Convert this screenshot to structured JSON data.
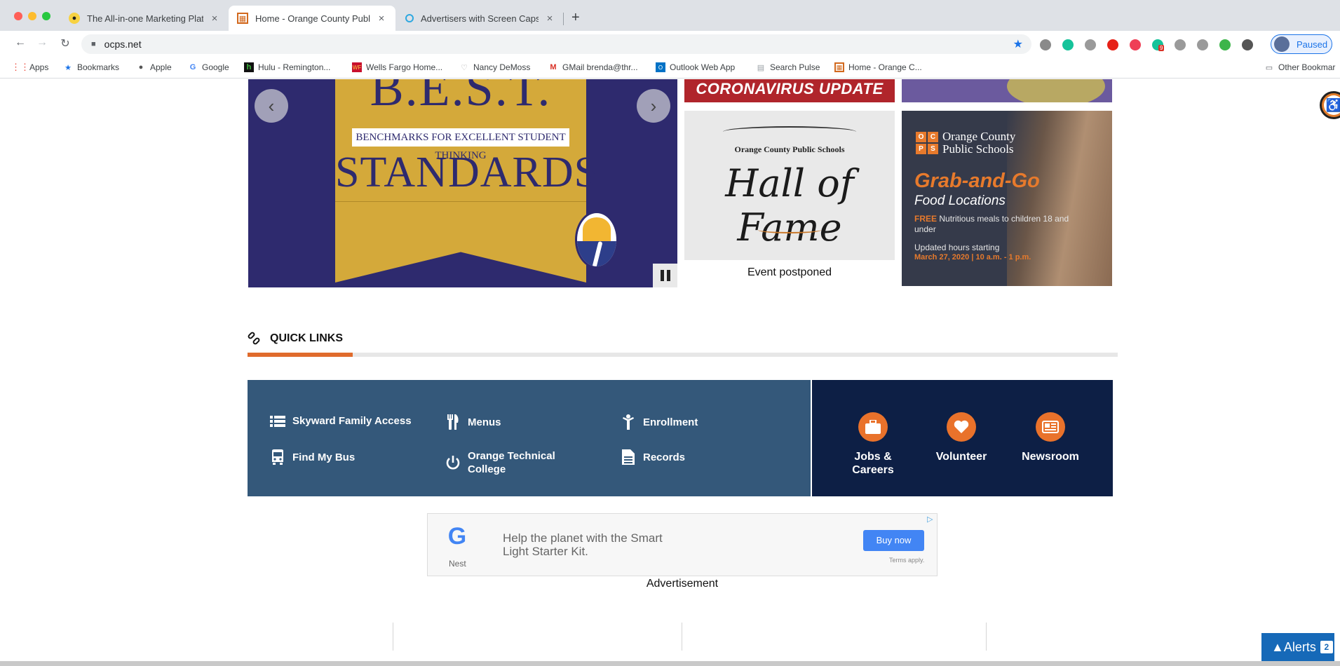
{
  "browser": {
    "tabs": [
      {
        "title": "The All-in-one Marketing Platfo",
        "active": false
      },
      {
        "title": "Home - Orange County Public",
        "active": true
      },
      {
        "title": "Advertisers with Screen Caps o",
        "active": false
      }
    ],
    "close_glyph": "×",
    "new_tab_glyph": "+",
    "url": "ocps.net",
    "profile_status": "Paused",
    "extension_badge": "9",
    "extensions": [
      {
        "name": "circle-ext-icon",
        "color": "#8a8a8a"
      },
      {
        "name": "grammarly-icon",
        "color": "#15c39a"
      },
      {
        "name": "drive-icon",
        "color": "#9a9a9a"
      },
      {
        "name": "youtube-icon",
        "color": "#e62117"
      },
      {
        "name": "pocket-icon",
        "color": "#ef3f56"
      },
      {
        "name": "grammarly-badge-icon",
        "color": "#15c39a"
      },
      {
        "name": "reader-icon",
        "color": "#9a9a9a"
      },
      {
        "name": "g-ext-icon",
        "color": "#9a9a9a"
      },
      {
        "name": "globe-icon",
        "color": "#3db54a"
      },
      {
        "name": "wordtune-icon",
        "color": "#555555"
      }
    ]
  },
  "bookmarks": {
    "items": [
      "Apps",
      "Bookmarks",
      "Apple",
      "Google",
      "Hulu - Remington...",
      "Wells Fargo Home...",
      "Nancy DeMoss",
      "GMail brenda@thr...",
      "Outlook Web App",
      "Search Pulse",
      "Home - Orange C..."
    ],
    "other": "Other Bookmar"
  },
  "carousel": {
    "heading_partial": "B.E.S.T.",
    "tagline": "BENCHMARKS FOR EXCELLENT STUDENT THINKING",
    "word": "STANDARDS",
    "prev_glyph": "‹",
    "next_glyph": "›"
  },
  "tiles": {
    "corona": "CORONAVIRUS UPDATE",
    "hof_org": "Orange County Public Schools",
    "hof_title": "Hall of Fame",
    "hof_caption": "Event postponed",
    "food": {
      "logo": [
        "O",
        "C",
        "P",
        "S"
      ],
      "org_line1": "Orange County",
      "org_line2": "Public Schools",
      "title": "Grab-and-Go",
      "subtitle": "Food Locations",
      "free_word": "FREE",
      "free_text": " Nutritious meals to children 18 and under",
      "updated": "Updated hours starting",
      "date": "March 27, 2020 | 10 a.m. - 1 p.m."
    }
  },
  "quick_links": {
    "heading": "QUICK LINKS",
    "items": [
      {
        "label": "Skyward Family Access",
        "icon": "list-icon"
      },
      {
        "label": "Menus",
        "icon": "fork-knife-icon"
      },
      {
        "label": "Enrollment",
        "icon": "person-icon"
      },
      {
        "label": "Find My Bus",
        "icon": "bus-icon"
      },
      {
        "label": "Orange Technical College",
        "icon": "power-icon"
      },
      {
        "label": "Records",
        "icon": "document-icon"
      }
    ],
    "featured": [
      {
        "label": "Jobs & Careers",
        "icon": "briefcase-icon"
      },
      {
        "label": "Volunteer",
        "icon": "heart-icon"
      },
      {
        "label": "Newsroom",
        "icon": "newspaper-icon"
      }
    ],
    "accent": "#e06b2c",
    "panel_color": "#34587a",
    "featured_color": "#0d1f45"
  },
  "ad": {
    "brand": "Nest",
    "logo_letter": "G",
    "copy": "Help the planet with the Smart Light Starter Kit.",
    "cta": "Buy now",
    "terms": "Terms apply.",
    "label": "Advertisement"
  },
  "alerts": {
    "label": "Alerts",
    "count": "2"
  }
}
